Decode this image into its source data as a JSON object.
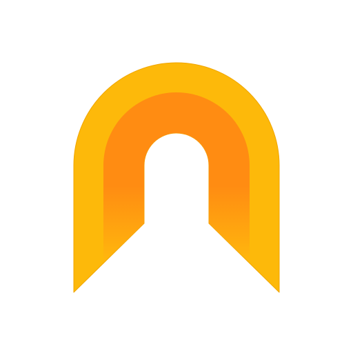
{
  "logo": {
    "icon": "tunnel-arch-icon",
    "colors": {
      "background": "#ffffff",
      "outer_arch": "#FDB90A",
      "outer_arch_edge": "#F0A500",
      "inner_arch_top": "#FF8C12",
      "inner_arch_bottom": "#FFB80D"
    }
  }
}
